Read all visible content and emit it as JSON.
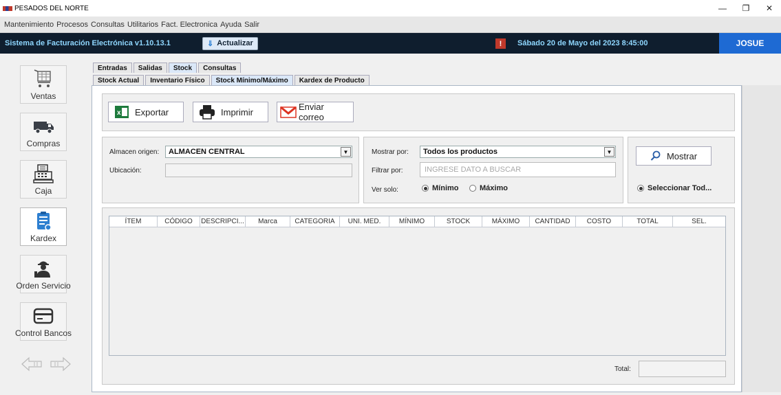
{
  "window": {
    "title": "PESADOS DEL NORTE"
  },
  "menu": [
    "Mantenimiento",
    "Procesos",
    "Consultas",
    "Utilitarios",
    "Fact. Electronica",
    "Ayuda",
    "Salir"
  ],
  "topbar": {
    "system": "Sistema de Facturación Electrónica v1.10.13.1",
    "update_label": "Actualizar",
    "alert": "!",
    "date": "Sábado 20 de Mayo del 2023 8:45:00",
    "user": "JOSUE"
  },
  "sidebar": {
    "items": [
      {
        "label": "Ventas",
        "icon": "cart-icon"
      },
      {
        "label": "Compras",
        "icon": "truck-icon"
      },
      {
        "label": "Caja",
        "icon": "cash-register-icon"
      },
      {
        "label": "Kardex",
        "icon": "clipboard-icon"
      },
      {
        "label": "Orden Servicio",
        "icon": "worker-icon"
      },
      {
        "label": "Control Bancos",
        "icon": "card-icon"
      }
    ]
  },
  "tabs": {
    "main": [
      "Entradas",
      "Salidas",
      "Stock",
      "Consultas"
    ],
    "main_active": "Stock",
    "sub": [
      "Stock Actual",
      "Inventario Físico",
      "Stock Mínimo/Máximo",
      "Kardex de Producto"
    ],
    "sub_active": "Stock Mínimo/Máximo"
  },
  "toolbar": {
    "export": "Exportar",
    "print": "Imprimir",
    "email": "Enviar correo"
  },
  "filters": {
    "almacen_label": "Almacen origen:",
    "almacen_value": "ALMACEN CENTRAL",
    "ubicacion_label": "Ubicación:",
    "mostrar_label": "Mostrar por:",
    "mostrar_value": "Todos los productos",
    "filtrar_label": "Filtrar por:",
    "filtrar_placeholder": "INGRESE DATO A BUSCAR",
    "ver_label": "Ver solo:",
    "radio_min": "Mínimo",
    "radio_max": "Máximo",
    "show_button": "Mostrar",
    "select_all": "Seleccionar Tod..."
  },
  "table": {
    "columns": [
      "ÍTEM",
      "CÓDIGO",
      "DESCRIPCI...",
      "Marca",
      "CATEGORIA",
      "UNI. MED.",
      "MÍNIMO",
      "STOCK",
      "MÁXIMO",
      "CANTIDAD",
      "COSTO",
      "TOTAL",
      "SEL."
    ]
  },
  "footer": {
    "total_label": "Total:"
  }
}
